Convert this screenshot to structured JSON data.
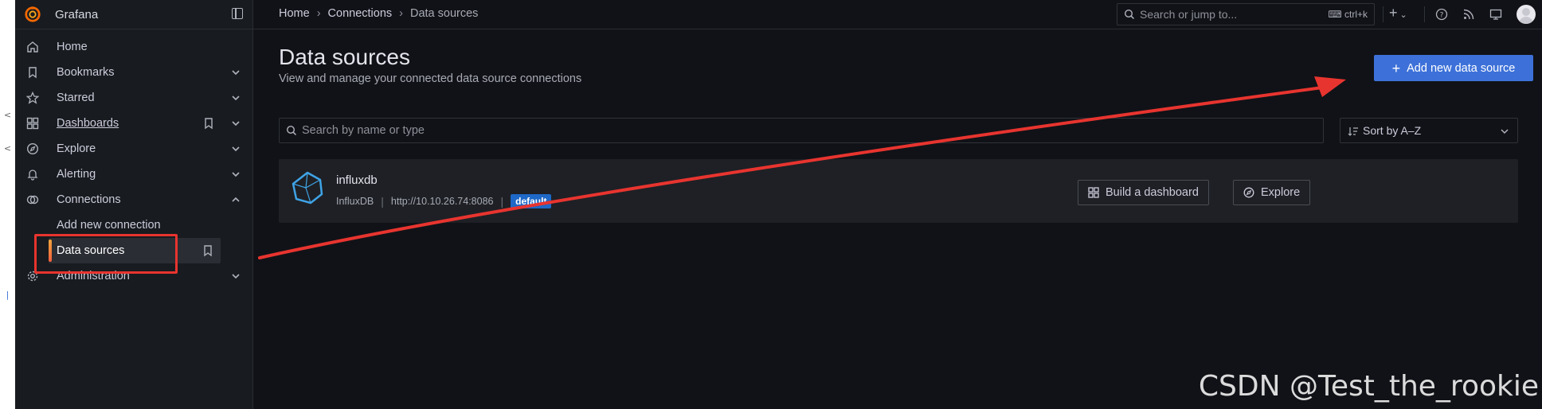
{
  "app": {
    "name": "Grafana"
  },
  "breadcrumb": {
    "items": [
      "Home",
      "Connections",
      "Data sources"
    ]
  },
  "topbar": {
    "search_placeholder": "Search or jump to...",
    "shortcut": "ctrl+k"
  },
  "sidebar": {
    "items": [
      {
        "label": "Home",
        "icon": "home-icon"
      },
      {
        "label": "Bookmarks",
        "icon": "bookmark-icon",
        "expandable": true
      },
      {
        "label": "Starred",
        "icon": "star-icon",
        "expandable": true
      },
      {
        "label": "Dashboards",
        "icon": "dashboards-icon",
        "expandable": true
      },
      {
        "label": "Explore",
        "icon": "compass-icon",
        "expandable": true
      },
      {
        "label": "Alerting",
        "icon": "bell-icon",
        "expandable": true
      },
      {
        "label": "Connections",
        "icon": "connections-icon",
        "expanded": true
      },
      {
        "label": "Add new connection"
      },
      {
        "label": "Data sources",
        "active": true
      },
      {
        "label": "Administration",
        "icon": "cog-icon",
        "expandable": true
      }
    ]
  },
  "page": {
    "title": "Data sources",
    "subtitle": "View and manage your connected data source connections",
    "add_button": "Add new data source",
    "search_placeholder": "Search by name or type",
    "sort_label": "Sort by A–Z"
  },
  "datasources": [
    {
      "name": "influxdb",
      "type": "InfluxDB",
      "url": "http://10.10.26.74:8086",
      "badge": "default",
      "build_button": "Build a dashboard",
      "explore_button": "Explore"
    }
  ],
  "watermark": "CSDN @Test_the_rookie",
  "colors": {
    "accent": "#3d71d9",
    "badge": "#1e68c7",
    "annotation": "#e8342f",
    "active_bar": "#f55f3e"
  }
}
